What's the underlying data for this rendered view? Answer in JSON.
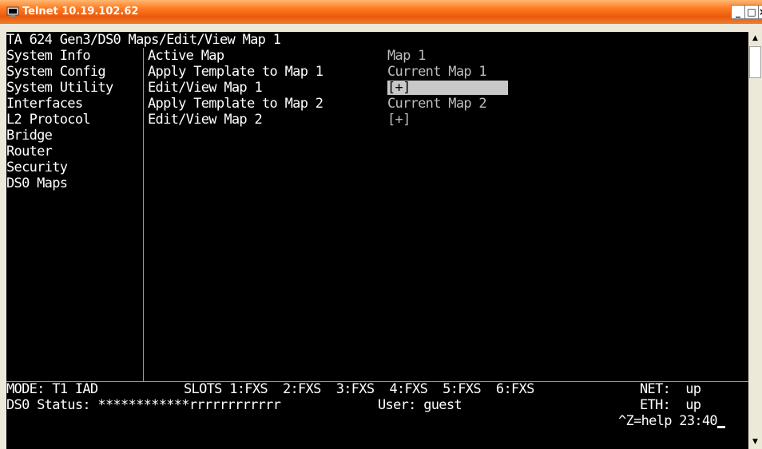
{
  "window": {
    "title": "Telnet 10.19.102.62",
    "buttons": {
      "minimize": "_",
      "maximize": "□",
      "close": "×"
    }
  },
  "terminal": {
    "header": "TA 624 Gen3/DS0 Maps/Edit/View Map 1",
    "menu": [
      "System Info",
      "System Config",
      "System Utility",
      "Interfaces",
      "L2 Protocol",
      "Bridge",
      "Router",
      "Security",
      "DS0 Maps"
    ],
    "menu_active": "DS0 Maps",
    "fields": [
      {
        "label": "Active Map",
        "value": "Map 1"
      },
      {
        "label": "Apply Template to Map 1",
        "value": "Current Map 1"
      },
      {
        "label": "Edit/View Map 1",
        "value": "[+]",
        "selected": true
      },
      {
        "label": "Apply Template to Map 2",
        "value": "Current Map 2"
      },
      {
        "label": "Edit/View Map 2",
        "value": "[+]"
      }
    ],
    "status": {
      "mode": "MODE: T1 IAD",
      "slots": "SLOTS 1:FXS  2:FXS  3:FXS  4:FXS  5:FXS  6:FXS",
      "net": "NET:  up",
      "ds0": "DS0 Status: ************rrrrrrrrrrrr",
      "user": "User: guest",
      "eth": "ETH:  up",
      "help": "^Z=help 23:40"
    }
  },
  "scrollbar": {
    "up": "▲",
    "down": "▼"
  },
  "colors": {
    "terminal_bg": "#000000",
    "terminal_fg": "#ffffff",
    "titlebar": "#ff7a21"
  }
}
